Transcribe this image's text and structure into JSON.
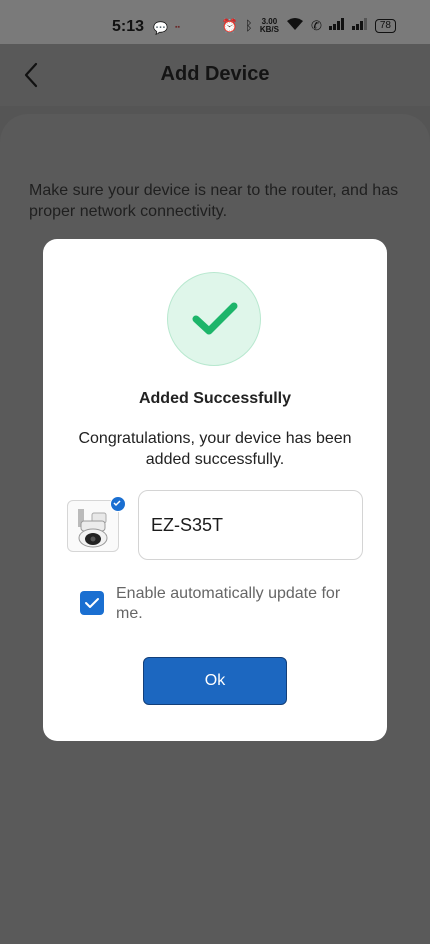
{
  "status_bar": {
    "time": "5:13",
    "network_speed_value": "3.00",
    "network_speed_unit": "KB/S",
    "battery": "78"
  },
  "header": {
    "title": "Add Device"
  },
  "main": {
    "hint": "Make sure your device is near to the router, and has proper network connectivity."
  },
  "dialog": {
    "title": "Added Successfully",
    "message": "Congratulations, your device has been added successfully.",
    "device_name": "EZ-S35T",
    "auto_update_label": "Enable automatically update for me.",
    "auto_update_checked": true,
    "ok_label": "Ok"
  },
  "colors": {
    "accent": "#1c67c0",
    "success": "#1db56a",
    "success_bg": "#dff6ea"
  }
}
